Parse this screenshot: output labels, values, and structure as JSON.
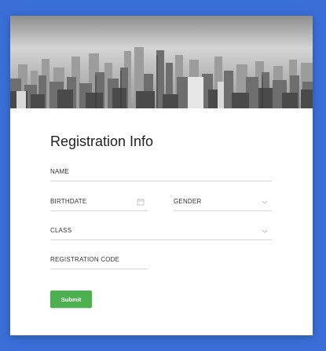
{
  "form": {
    "title": "Registration Info",
    "fields": {
      "name": {
        "label": "NAME"
      },
      "birthdate": {
        "label": "BIRTHDATE",
        "icon": "calendar-icon"
      },
      "gender": {
        "label": "GENDER",
        "icon": "chevron-down-icon"
      },
      "class": {
        "label": "CLASS",
        "icon": "chevron-down-icon"
      },
      "registration_code": {
        "label": "REGISTRATION CODE"
      }
    },
    "submit_label": "Submit"
  },
  "colors": {
    "background": "#3a6fd8",
    "card": "#ffffff",
    "submit": "#4caf50"
  }
}
